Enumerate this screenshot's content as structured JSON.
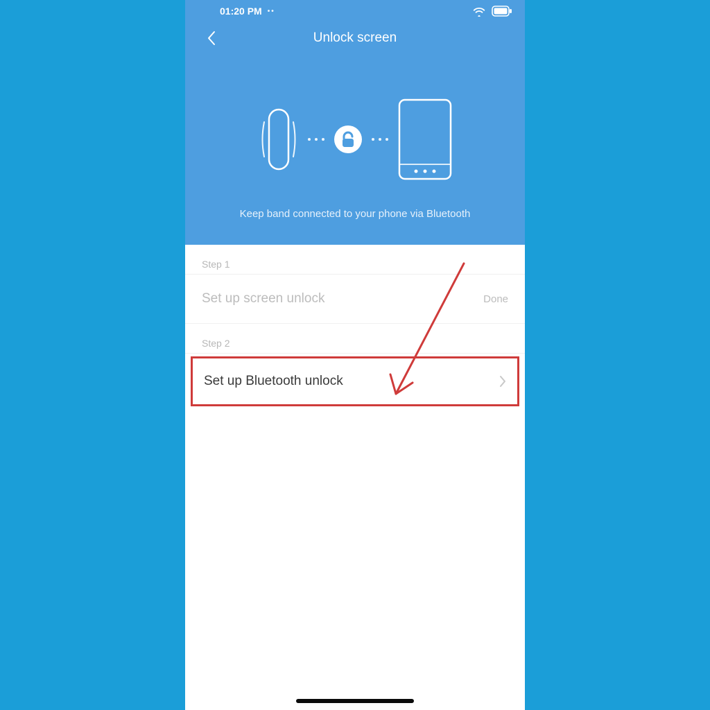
{
  "status": {
    "time": "01:20 PM",
    "extra": "••"
  },
  "header": {
    "title": "Unlock screen"
  },
  "hero": {
    "caption": "Keep band connected to your phone via Bluetooth"
  },
  "steps": {
    "s1_label": "Step 1",
    "s1_title": "Set up screen unlock",
    "s1_status": "Done",
    "s2_label": "Step 2",
    "s2_title": "Set up Bluetooth unlock"
  },
  "colors": {
    "header_bg": "#4e9ee0",
    "page_bg": "#1b9ed8",
    "highlight": "#cf3b3a"
  }
}
